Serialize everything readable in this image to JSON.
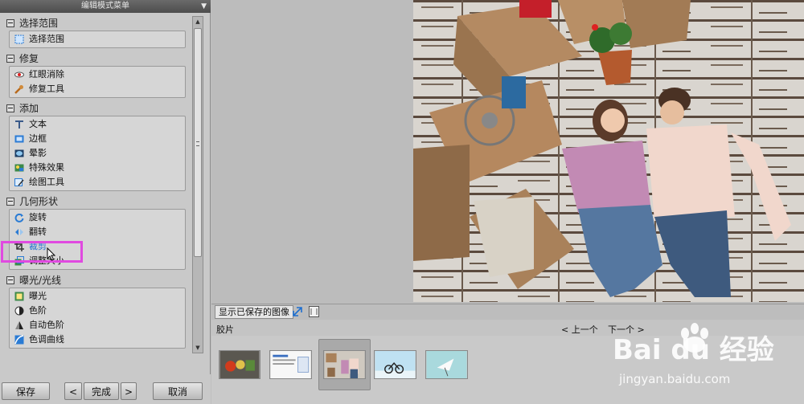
{
  "panel": {
    "title": "编辑模式菜单"
  },
  "sections": [
    {
      "title": "选择范围",
      "items": [
        {
          "label": "选择范围",
          "icon": "selection-icon"
        }
      ]
    },
    {
      "title": "修复",
      "items": [
        {
          "label": "红眼消除",
          "icon": "red-eye-icon"
        },
        {
          "label": "修复工具",
          "icon": "repair-tool-icon"
        }
      ]
    },
    {
      "title": "添加",
      "items": [
        {
          "label": "文本",
          "icon": "text-icon"
        },
        {
          "label": "边框",
          "icon": "border-icon"
        },
        {
          "label": "晕影",
          "icon": "vignette-icon"
        },
        {
          "label": "特殊效果",
          "icon": "special-effects-icon"
        },
        {
          "label": "绘图工具",
          "icon": "drawing-tool-icon"
        }
      ]
    },
    {
      "title": "几何形状",
      "items": [
        {
          "label": "旋转",
          "icon": "rotate-icon"
        },
        {
          "label": "翻转",
          "icon": "flip-icon"
        },
        {
          "label": "裁剪",
          "icon": "crop-icon"
        },
        {
          "label": "调整大小",
          "icon": "resize-icon"
        }
      ]
    },
    {
      "title": "曝光/光线",
      "items": [
        {
          "label": "曝光",
          "icon": "exposure-icon"
        },
        {
          "label": "色阶",
          "icon": "levels-icon"
        },
        {
          "label": "自动色阶",
          "icon": "auto-levels-icon"
        },
        {
          "label": "色调曲线",
          "icon": "tone-curve-icon"
        }
      ]
    }
  ],
  "buttons": {
    "save": "保存",
    "prev": "<",
    "done": "完成",
    "next": ">",
    "cancel": "取消"
  },
  "tabs": {
    "saved_images": "显示已保存的图像"
  },
  "filmstrip": {
    "label": "胶片",
    "prev": "< 上一个",
    "next": "下一个 >"
  },
  "watermark": {
    "brand": "Bai du 经验",
    "url": "jingyan.baidu.com"
  },
  "colors": {
    "highlight": "#e04ae0",
    "accent": "#1e6fd0"
  }
}
